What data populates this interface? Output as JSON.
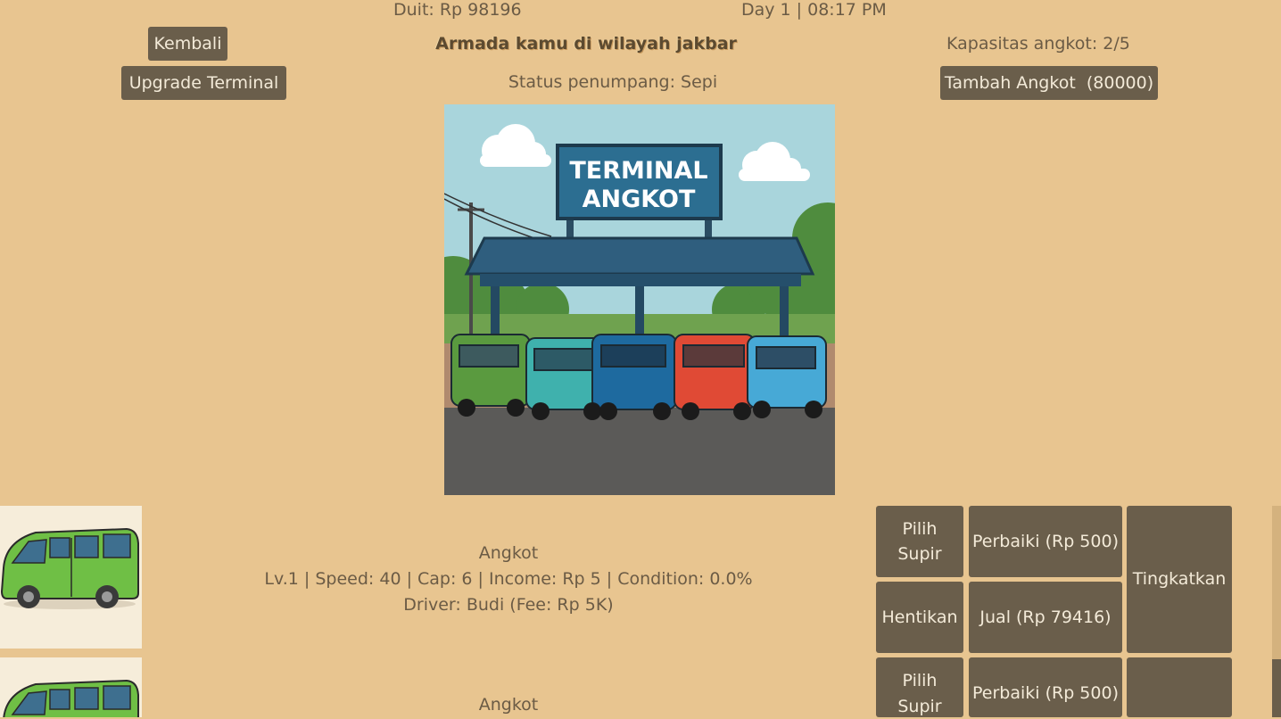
{
  "header": {
    "money": "Duit: Rp 98196",
    "clock": "Day 1 | 08:17 PM",
    "title": "Armada kamu di wilayah jakbar",
    "status": "Status penumpang: Sepi",
    "capacity": "Kapasitas angkot: 2/5"
  },
  "buttons": {
    "back": "Kembali",
    "upgrade_terminal": "Upgrade Terminal",
    "add_angkot": "Tambah Angkot  (80000)"
  },
  "scene": {
    "sign_line1": "TERMINAL",
    "sign_line2": "ANGKOT"
  },
  "fleet": [
    {
      "name": "Angkot",
      "stats": "Lv.1 | Speed: 40 | Cap: 6 | Income: Rp 5 | Condition: 0.0%",
      "driver": "Driver: Budi (Fee: Rp 5K)",
      "actions": {
        "choose_driver": "Pilih Supir",
        "repair": "Perbaiki (Rp 500)",
        "upgrade": "Tingkatkan",
        "stop": "Hentikan",
        "sell": "Jual (Rp 79416)"
      }
    },
    {
      "name": "Angkot",
      "actions": {
        "choose_driver": "Pilih Supir",
        "repair": "Perbaiki (Rp 500)"
      }
    }
  ],
  "colors": {
    "background": "#e8c590",
    "button": "#6a5e4b",
    "text": "#6b5b45"
  }
}
